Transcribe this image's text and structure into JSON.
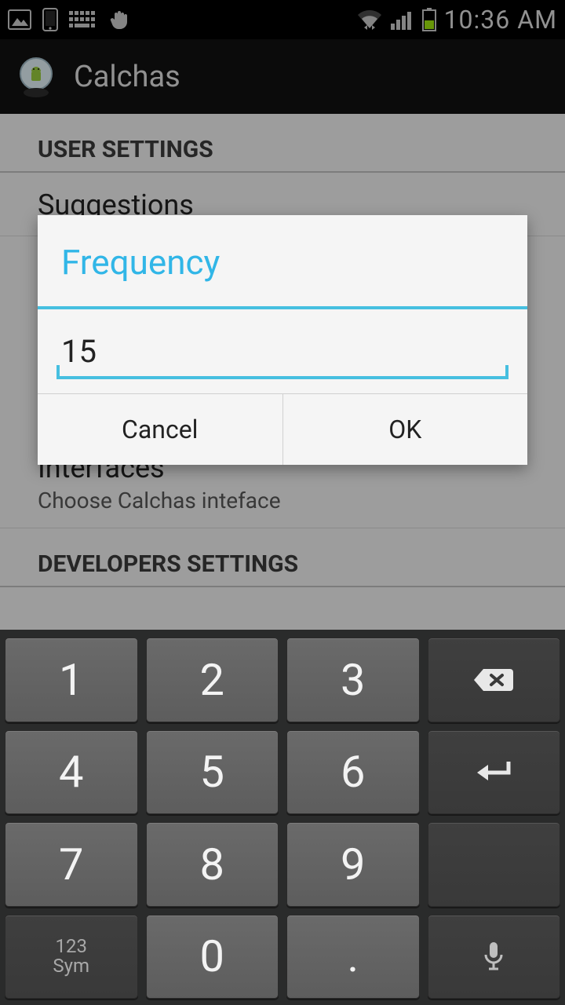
{
  "status": {
    "time": "10:36 AM",
    "icons_left": [
      "image-icon",
      "phone-portrait-icon",
      "keyboard-icon",
      "hand-icon"
    ],
    "icons_right": [
      "wifi-icon",
      "signal-icon",
      "battery-icon"
    ]
  },
  "appbar": {
    "title": "Calchas",
    "icon": "android-crystal-ball-icon"
  },
  "settings": {
    "sections": [
      {
        "header": "USER SETTINGS",
        "items": [
          {
            "title": "Suggestions",
            "subtitle": ""
          },
          {
            "title": "Interfaces",
            "subtitle": "Choose Calchas inteface"
          }
        ]
      },
      {
        "header": "DEVELOPERS SETTINGS",
        "items": []
      }
    ]
  },
  "dialog": {
    "title": "Frequency",
    "value": "15",
    "buttons": {
      "cancel": "Cancel",
      "ok": "OK"
    }
  },
  "keyboard": {
    "rows": [
      [
        "1",
        "2",
        "3",
        "backspace"
      ],
      [
        "4",
        "5",
        "6",
        "enter"
      ],
      [
        "7",
        "8",
        "9",
        "blank"
      ],
      [
        "sym",
        "0",
        ".",
        "mic"
      ]
    ],
    "labels": {
      "sym_line1": "123",
      "sym_line2": "Sym",
      "dot": "."
    }
  }
}
